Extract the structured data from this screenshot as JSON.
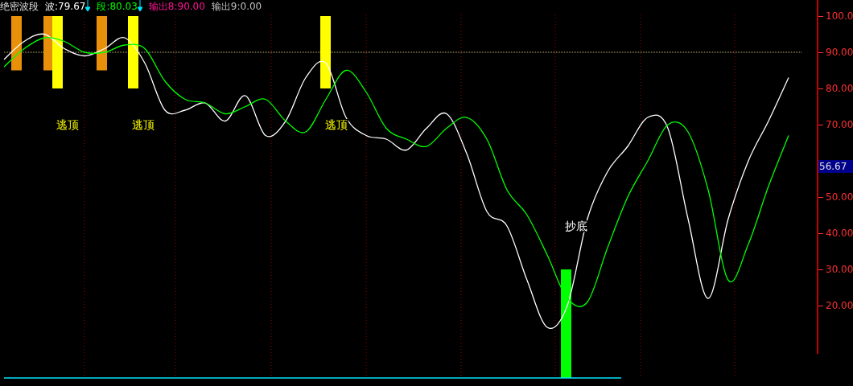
{
  "legend": {
    "title": "绝密波段",
    "items": [
      {
        "kind": "series",
        "label": ":79.67",
        "color": "#ffffff",
        "arrow": true
      },
      {
        "kind": "series",
        "label": ":80.03",
        "color": "#00ff00",
        "arrow": true
      },
      {
        "kind": "text",
        "label": "输出8:90.00",
        "color": "#ff1493",
        "arrow": false
      },
      {
        "kind": "text",
        "label": "输出9:0.00",
        "color": "#c0c0c0",
        "arrow": false
      }
    ]
  },
  "chart_data": {
    "type": "line",
    "ylim": [
      6.67,
      104
    ],
    "yticks": [
      {
        "value": 100,
        "label": "100.0"
      },
      {
        "value": 90,
        "label": "90.00"
      },
      {
        "value": 80,
        "label": "80.00"
      },
      {
        "value": 70,
        "label": "70.00"
      },
      {
        "value": 50,
        "label": "50.00"
      },
      {
        "value": 40,
        "label": "40.00"
      },
      {
        "value": 30,
        "label": "30.00"
      },
      {
        "value": 20,
        "label": "20.00"
      }
    ],
    "series": [
      {
        "name": "波",
        "color": "#ffffff",
        "values": [
          88,
          93,
          95,
          91,
          89,
          91,
          94,
          87,
          74,
          74,
          76,
          71,
          78,
          67,
          71,
          83,
          87,
          72,
          67,
          66,
          63,
          69,
          73,
          62,
          46,
          42,
          27,
          14,
          20,
          44,
          57,
          64,
          72,
          69,
          44,
          22,
          44,
          60,
          71,
          83
        ]
      },
      {
        "name": "段",
        "color": "#00ff00",
        "values": [
          86,
          91,
          94,
          93,
          90,
          90,
          92,
          91,
          82,
          77,
          76,
          73,
          75,
          77,
          71,
          68,
          77,
          85,
          79,
          69,
          66,
          64,
          69,
          72,
          66,
          52,
          45,
          34,
          22,
          21,
          36,
          50,
          60,
          70,
          68,
          52,
          27,
          37,
          53,
          67
        ]
      }
    ]
  },
  "bars": [
    {
      "color": "#e8900a"
    },
    {
      "color": "#e8900a"
    },
    {
      "color": "#e8900a"
    },
    {
      "color": "#ffff00"
    },
    {
      "color": "#ffff00"
    },
    {
      "color": "#ffff00"
    },
    {
      "color": "#00ff00"
    }
  ],
  "signals": [
    {
      "kind": "top",
      "text": "逃顶"
    },
    {
      "kind": "top",
      "text": "逃顶"
    },
    {
      "kind": "top",
      "text": "逃顶"
    },
    {
      "kind": "bottom",
      "text": "抄底"
    }
  ],
  "current_value": "56.67"
}
